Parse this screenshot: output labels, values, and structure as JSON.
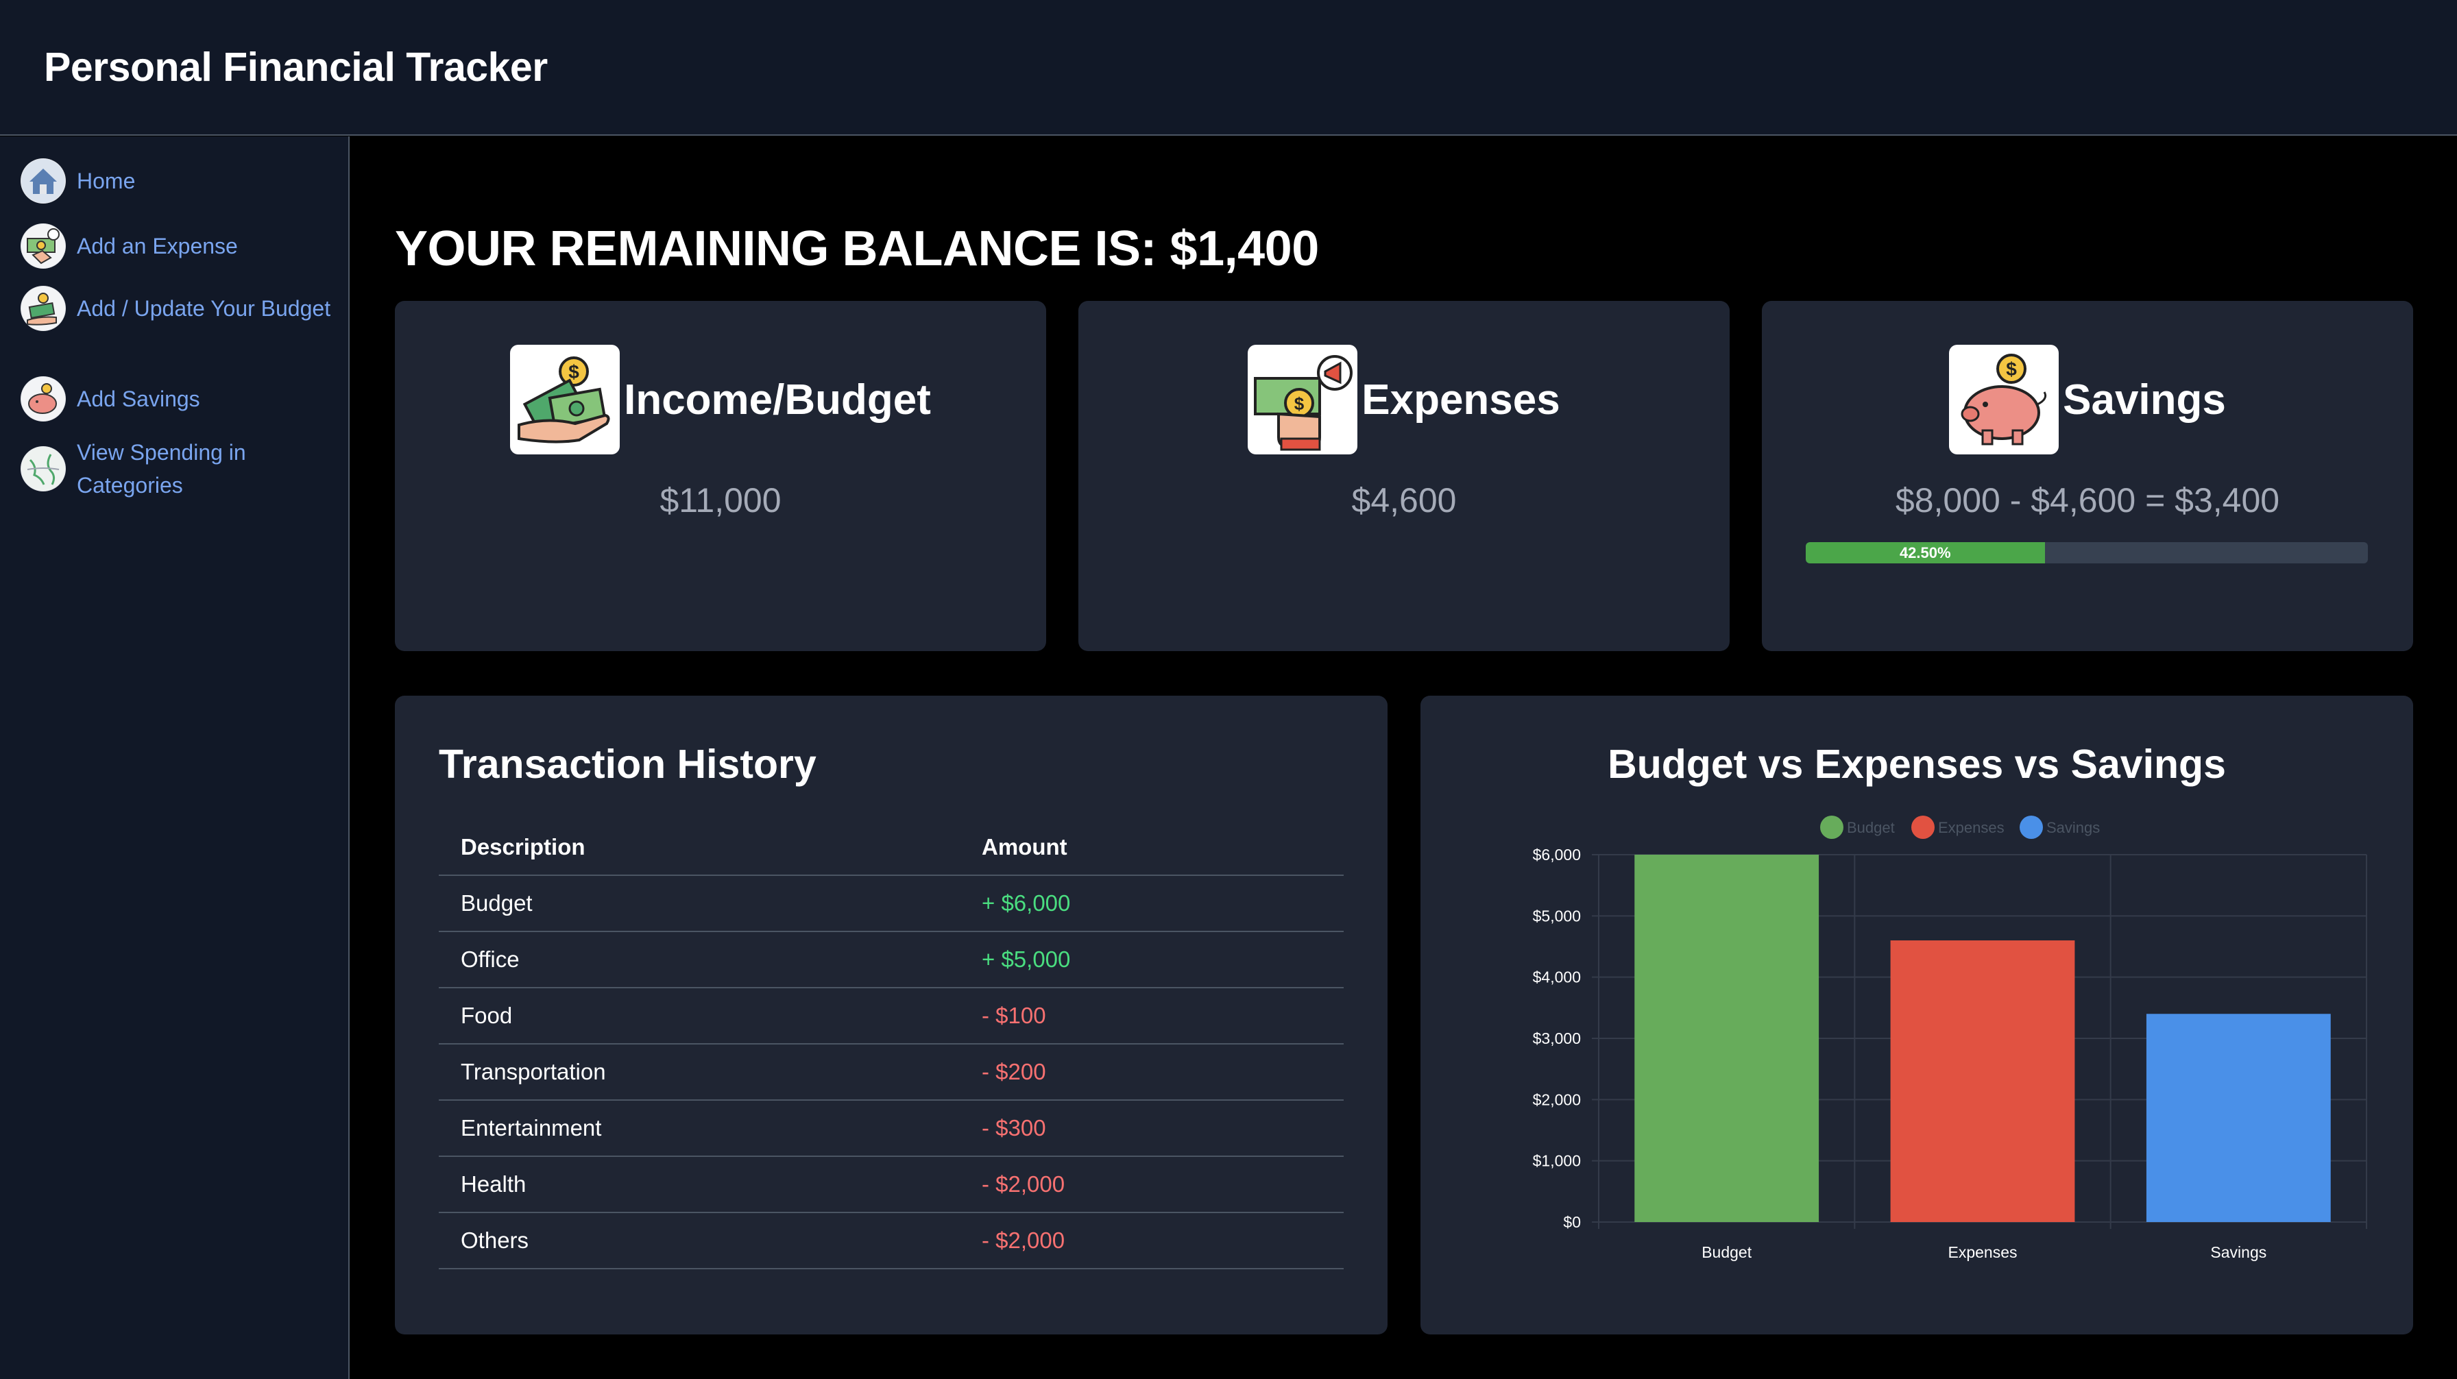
{
  "header": {
    "title": "Personal Financial Tracker"
  },
  "sidebar": {
    "items": [
      {
        "label": "Home",
        "icon": "home-icon"
      },
      {
        "label": "Add an Expense",
        "icon": "money-hand-icon"
      },
      {
        "label": "Add / Update Your Budget",
        "icon": "budget-icon"
      },
      {
        "label": "Add Savings",
        "icon": "piggy-bank-icon"
      },
      {
        "label": "View Spending in Categories",
        "icon": "map-icon"
      }
    ]
  },
  "main": {
    "balance_text": "YOUR REMAINING BALANCE IS: $1,400",
    "cards": {
      "income": {
        "title": "Income/Budget",
        "value": "$11,000",
        "icon": "money-hand-icon"
      },
      "expenses": {
        "title": "Expenses",
        "value": "$4,600",
        "icon": "megaphone-money-icon"
      },
      "savings": {
        "title": "Savings",
        "value": "$8,000 - $4,600 = $3,400",
        "icon": "piggy-bank-icon",
        "progress": 42.5,
        "progress_label": "42.50%"
      }
    },
    "transactions": {
      "title": "Transaction History",
      "headers": [
        "Description",
        "Amount"
      ],
      "rows": [
        {
          "description": "Budget",
          "amount": "+ $6,000",
          "type": "income"
        },
        {
          "description": "Office",
          "amount": "+ $5,000",
          "type": "income"
        },
        {
          "description": "Food",
          "amount": "- $100",
          "type": "expense"
        },
        {
          "description": "Transportation",
          "amount": "- $200",
          "type": "expense"
        },
        {
          "description": "Entertainment",
          "amount": "- $300",
          "type": "expense"
        },
        {
          "description": "Health",
          "amount": "- $2,000",
          "type": "expense"
        },
        {
          "description": "Others",
          "amount": "- $2,000",
          "type": "expense"
        }
      ]
    },
    "chart_title": "Budget vs Expenses vs Savings"
  },
  "colors": {
    "income": "#4ade80",
    "expense": "#f87171",
    "link": "#7aa5ef",
    "card": "#1f2533"
  },
  "chart_data": {
    "type": "bar",
    "title": "Budget vs Expenses vs Savings",
    "categories": [
      "Budget",
      "Expenses",
      "Savings"
    ],
    "values": [
      6000,
      4600,
      3400
    ],
    "colors": [
      "#67ac5b",
      "#e15241",
      "#4a90e8"
    ],
    "legend": [
      "Budget",
      "Expenses",
      "Savings"
    ],
    "legend_position": "top",
    "ylim": [
      0,
      6000
    ],
    "yticks": [
      "$0",
      "$1,000",
      "$2,000",
      "$3,000",
      "$4,000",
      "$5,000",
      "$6,000"
    ],
    "grid": true
  }
}
